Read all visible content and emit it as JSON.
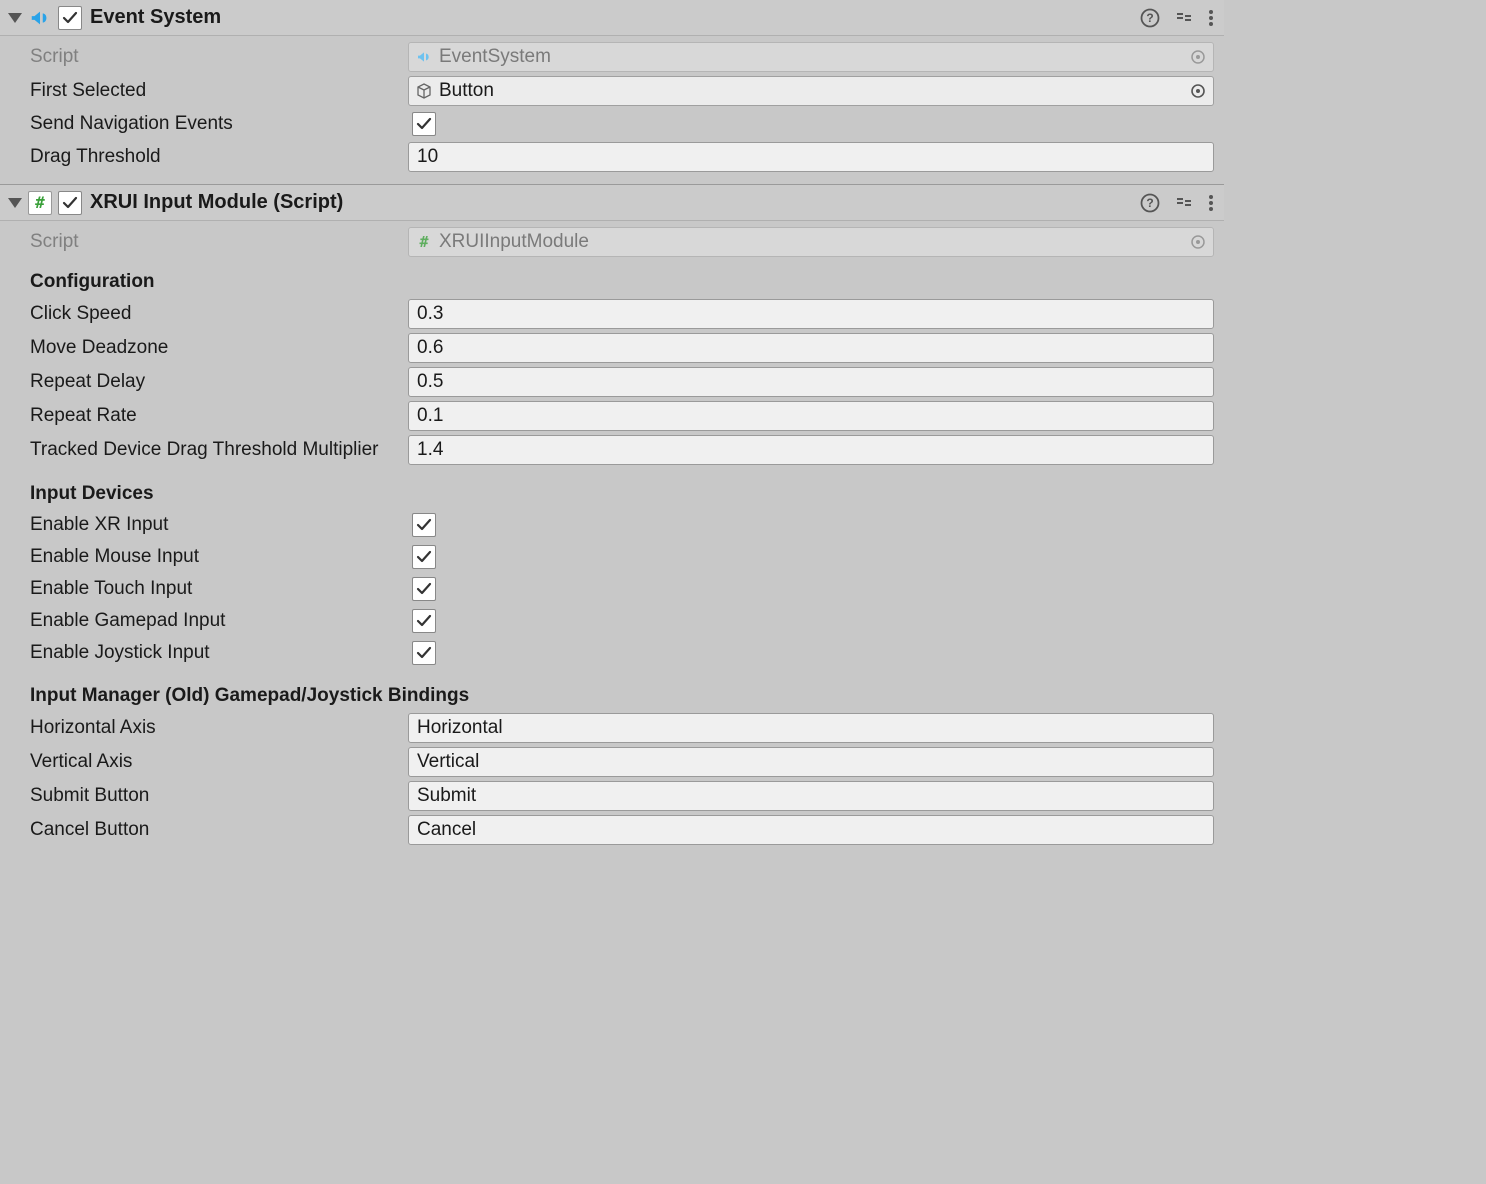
{
  "components": {
    "eventSystem": {
      "title": "Event System",
      "enabled": true,
      "scriptLabel": "Script",
      "scriptValue": "EventSystem",
      "firstSelectedLabel": "First Selected",
      "firstSelectedValue": "Button",
      "sendNavLabel": "Send Navigation Events",
      "sendNavChecked": true,
      "dragThresholdLabel": "Drag Threshold",
      "dragThresholdValue": "10"
    },
    "xrui": {
      "title": "XRUI Input Module (Script)",
      "enabled": true,
      "scriptLabel": "Script",
      "scriptValue": "XRUIInputModule",
      "sections": {
        "config": {
          "header": "Configuration",
          "clickSpeedLabel": "Click Speed",
          "clickSpeedValue": "0.3",
          "moveDeadzoneLabel": "Move Deadzone",
          "moveDeadzoneValue": "0.6",
          "repeatDelayLabel": "Repeat Delay",
          "repeatDelayValue": "0.5",
          "repeatRateLabel": "Repeat Rate",
          "repeatRateValue": "0.1",
          "trackedMultLabel": "Tracked Device Drag Threshold Multiplier",
          "trackedMultValue": "1.4"
        },
        "devices": {
          "header": "Input Devices",
          "xrLabel": "Enable XR Input",
          "xrChecked": true,
          "mouseLabel": "Enable Mouse Input",
          "mouseChecked": true,
          "touchLabel": "Enable Touch Input",
          "touchChecked": true,
          "gamepadLabel": "Enable Gamepad Input",
          "gamepadChecked": true,
          "joystickLabel": "Enable Joystick Input",
          "joystickChecked": true
        },
        "bindings": {
          "header": "Input Manager (Old) Gamepad/Joystick Bindings",
          "hAxisLabel": "Horizontal Axis",
          "hAxisValue": "Horizontal",
          "vAxisLabel": "Vertical Axis",
          "vAxisValue": "Vertical",
          "submitLabel": "Submit Button",
          "submitValue": "Submit",
          "cancelLabel": "Cancel Button",
          "cancelValue": "Cancel"
        }
      }
    }
  }
}
